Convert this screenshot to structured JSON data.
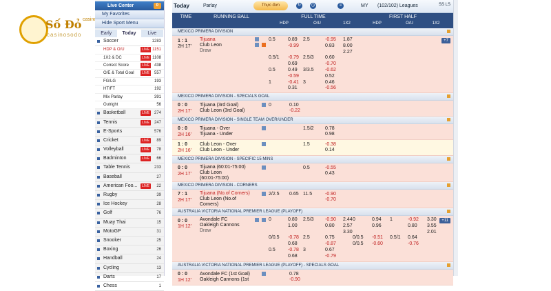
{
  "logo": {
    "name": "Số Đỏ",
    "sub": "casino",
    "domain": "casinosodo"
  },
  "left": {
    "live_center": "Live Center",
    "live_center_count": "0",
    "my_favorites": "My Favorites",
    "hide_menu": "Hide Sport Menu",
    "tabs": [
      "Early",
      "Today",
      "Live"
    ],
    "soccer": {
      "label": "Soccer",
      "count": "1283"
    },
    "soccer_sub": [
      {
        "label": "HDP & O/U",
        "count": "1151",
        "live": true,
        "red": true
      },
      {
        "label": "1X2 & DC",
        "count": "1108",
        "live": true
      },
      {
        "label": "Correct Score",
        "count": "438",
        "live": true
      },
      {
        "label": "O/E & Total Goal",
        "count": "557",
        "live": true
      },
      {
        "label": "FG/LG",
        "count": "193"
      },
      {
        "label": "HT/FT",
        "count": "192"
      },
      {
        "label": "Mix Parlay",
        "count": "391"
      },
      {
        "label": "Outright",
        "count": "56"
      }
    ],
    "sports": [
      {
        "label": "Basketball",
        "count": "274",
        "live": true
      },
      {
        "label": "Tennis",
        "count": "247",
        "live": true
      },
      {
        "label": "E-Sports",
        "count": "576"
      },
      {
        "label": "Cricket",
        "count": "89",
        "live": true
      },
      {
        "label": "Volleyball",
        "count": "78",
        "live": true
      },
      {
        "label": "Badminton",
        "count": "66",
        "live": true
      },
      {
        "label": "Table Tennis",
        "count": "233"
      },
      {
        "label": "Baseball",
        "count": "27"
      },
      {
        "label": "American Foo...",
        "count": "22",
        "live": true
      },
      {
        "label": "Rugby",
        "count": "39"
      },
      {
        "label": "Ice Hockey",
        "count": "28"
      },
      {
        "label": "Golf",
        "count": "76"
      },
      {
        "label": "Muay Thai",
        "count": "15"
      },
      {
        "label": "MotoGP",
        "count": "31"
      },
      {
        "label": "Snooker",
        "count": "25"
      },
      {
        "label": "Boxing",
        "count": "26"
      },
      {
        "label": "Handball",
        "count": "24"
      },
      {
        "label": "Cycling",
        "count": "13"
      },
      {
        "label": "Darts",
        "count": "17"
      },
      {
        "label": "Chess",
        "count": "1"
      }
    ]
  },
  "top": {
    "today": "Today",
    "parlay": "Parlay",
    "mode": "Thực đơn",
    "my": "MY",
    "leagues": "(102/102) Leagues",
    "ss": "SS",
    "ls": "LS"
  },
  "head": {
    "time": "TIME",
    "running": "RUNNING BALL",
    "full": "FULL TIME",
    "first": "FIRST HALF",
    "hdp": "HDP",
    "ou": "O/U",
    "x12": "1X2",
    "hdp2": "HDP",
    "ou2": "O/U",
    "x122": "1X2"
  },
  "leagues": [
    {
      "name": "MEXICO PRIMERA DIVISION"
    },
    {
      "name": "MEXICO PRIMERA DIVISION - SPECIALS GOAL"
    },
    {
      "name": "MEXICO PRIMERA DIVISION - SINGLE TEAM OVER/UNDER"
    },
    {
      "name": "MEXICO PRIMERA DIVISION - SPECIFIC 15 MINS"
    },
    {
      "name": "MEXICO PRIMERA DIVISION - CORNERS"
    },
    {
      "name": "AUSTRALIA VICTORIA NATIONAL PREMIER LEAGUE (PLAYOFF)"
    },
    {
      "name": "AUSTRALIA VICTORIA NATIONAL PREMIER LEAGUE (PLAYOFF) - SPECIALS GOAL"
    }
  ],
  "m1": {
    "score": "1 : 1",
    "time": "2H 17'",
    "home": "Tijuana",
    "away": "Club Leon",
    "draw": "Draw",
    "chip": "+7",
    "odds": [
      [
        "0.5",
        "0.89",
        "2.5",
        "-0.95",
        "1.87"
      ],
      [
        "",
        "-0.99",
        "",
        "0.83",
        "8.00"
      ],
      [
        "",
        "",
        "",
        "",
        "2.27"
      ],
      [
        "0.5/1",
        "-0.79",
        "2.5/3",
        "0.60",
        ""
      ],
      [
        "",
        "0.69",
        "",
        "-0.70",
        ""
      ],
      [
        "0.5",
        "0.49",
        "3/3.5",
        "-0.62",
        ""
      ],
      [
        "",
        "-0.59",
        "",
        "0.52",
        ""
      ],
      [
        "1",
        "-0.41",
        "3",
        "0.46",
        ""
      ],
      [
        "",
        "0.31",
        "",
        "-0.56",
        ""
      ]
    ]
  },
  "m2": {
    "score": "0 : 0",
    "time": "2H 17'",
    "home": "Tijuana (3rd Goal)",
    "away": "Club Leon (3rd Goal)",
    "o1": "0",
    "o2": "0.10",
    "o3": "-0.22"
  },
  "m3a": {
    "score": "0 : 0",
    "time": "2H 16'",
    "home": "Tijuana - Over",
    "away": "Tijuana - Under",
    "h": "1.5/2",
    "o1": "0.78",
    "o2": "0.98"
  },
  "m3b": {
    "score": "1 : 0",
    "time": "2H 16'",
    "home": "Club Leon - Over",
    "away": "Club Leon - Under",
    "h": "1.5",
    "o1": "-0.38",
    "o2": "0.14"
  },
  "m4": {
    "score": "0 : 0",
    "time": "2H 17'",
    "home": "Tijuana (60:01-75:00)",
    "away": "Club Leon (60:01-75:00)",
    "h": "0.5",
    "o1": "-0.55",
    "o2": "0.43"
  },
  "m5": {
    "score": "7 : 1",
    "time": "2H 17'",
    "home": "Tijuana (No.of Corners)",
    "away": "Club Leon (No.of Corners)",
    "h": "2/2.5",
    "a": "0.65",
    "h2": "11.5",
    "b": "-0.90",
    "c": "-0.70"
  },
  "m6": {
    "score": "0 : 0",
    "time": "1H 12'",
    "home": "Avondale FC",
    "away": "Oakleigh Cannons",
    "draw": "Draw",
    "chip": "+11",
    "r1": [
      "0",
      "0.80",
      "2.5/3",
      "-0.90",
      "2.44",
      "0",
      "0.94",
      "1",
      "-0.92",
      "3.30"
    ],
    "r2": [
      "",
      "1.00",
      "",
      "0.80",
      "2.57",
      "",
      "0.96",
      "",
      "0.80",
      "3.55"
    ],
    "r3": [
      "",
      "",
      "",
      "",
      "3.30",
      "",
      "",
      "",
      "",
      "2.01"
    ],
    "r4": [
      "0/0.5",
      "-0.78",
      "2.5",
      "0.75",
      "",
      "0/0.5",
      "-0.51",
      "0.5/1",
      "0.64",
      ""
    ],
    "r5": [
      "",
      "0.68",
      "",
      "-0.87",
      "",
      "0/0.5",
      "-0.60",
      "",
      "-0.76",
      ""
    ],
    "r6": [
      "0.5",
      "-0.78",
      "3",
      "0.67"
    ],
    "r7": [
      "",
      "0.68",
      "",
      "-0.79"
    ]
  },
  "m7": {
    "score": "0 : 0",
    "time": "1H 12'",
    "home": "Avondale FC (1st Goal)",
    "away": "Oakleigh Cannons (1st",
    "o1": "0.78",
    "o2": "-0.90"
  }
}
